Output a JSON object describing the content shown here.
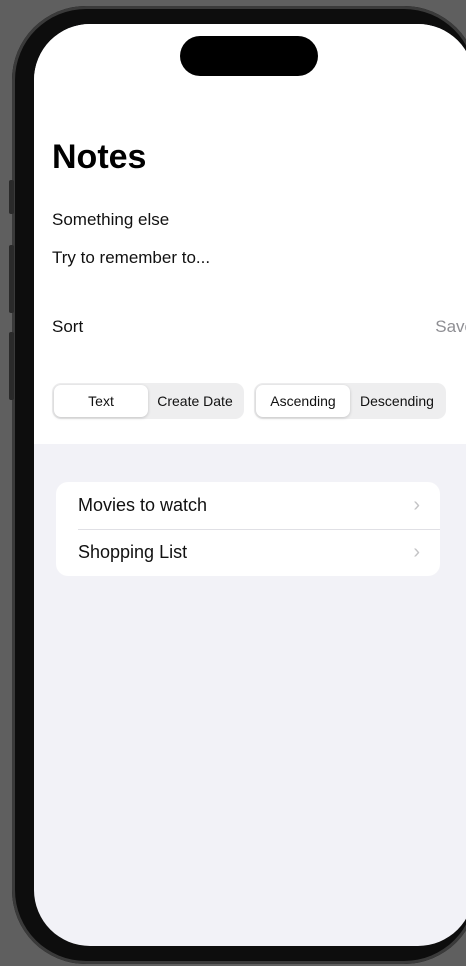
{
  "page": {
    "title": "Notes"
  },
  "notes": [
    "Something else",
    "Try to remember to..."
  ],
  "sort": {
    "label": "Sort",
    "save_label": "Save",
    "field_options": [
      "Text",
      "Create Date"
    ],
    "field_selected": "Text",
    "order_options": [
      "Ascending",
      "Descending"
    ],
    "order_selected": "Ascending"
  },
  "lists": [
    {
      "label": "Movies to watch",
      "icon": "chevron-right-icon"
    },
    {
      "label": "Shopping List",
      "icon": "chevron-right-icon"
    }
  ],
  "colors": {
    "accent_gray": "#8e8e93",
    "grouped_background": "#f2f2f7"
  }
}
